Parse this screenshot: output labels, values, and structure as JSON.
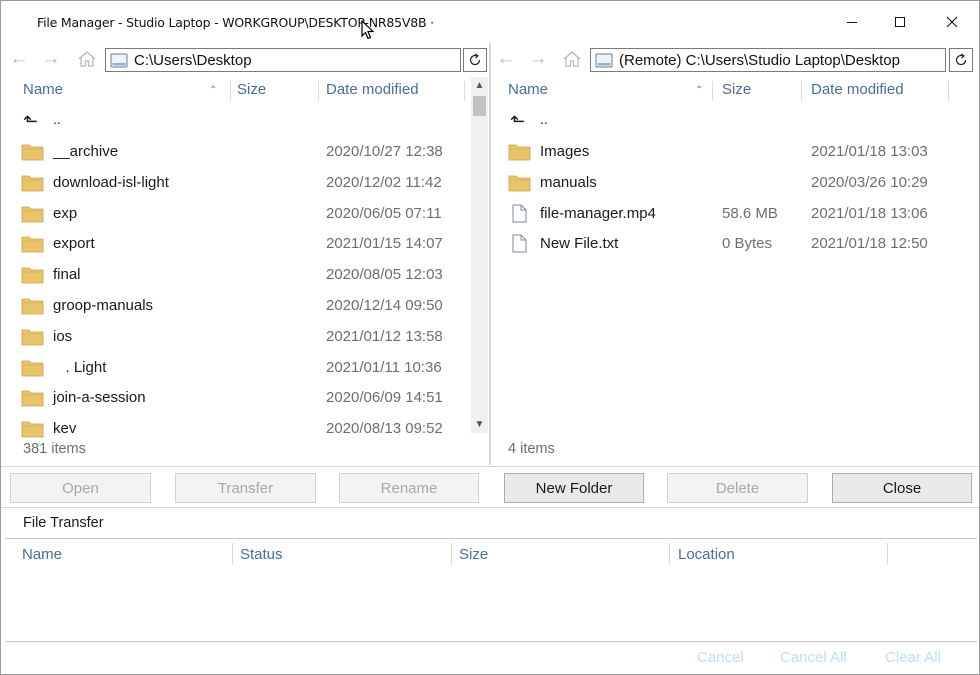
{
  "window": {
    "title": "File Manager - Studio Laptop - WORKGROUP\\DESKTOP-NR85V8B ·"
  },
  "icons": {
    "minimize": "minimize-icon",
    "maximize": "maximize-icon",
    "close": "close-icon",
    "back": "arrow-left-icon",
    "forward": "arrow-right-icon",
    "home": "home-icon",
    "drive": "drive-icon",
    "refresh": "refresh-icon",
    "folder": "folder-icon",
    "file": "file-icon",
    "parent": "parent-directory-icon"
  },
  "colors": {
    "header_text": "#4a6d9a",
    "folder": "#e9c46a",
    "disabled_link": "#bfe0f0"
  },
  "left_pane": {
    "path": "C:\\Users\\Desktop",
    "columns": {
      "name": "Name",
      "size": "Size",
      "date": "Date modified"
    },
    "parent_label": "..",
    "items": [
      {
        "name": "__archive",
        "size": "",
        "date": "2020/10/27 12:38",
        "type": "folder"
      },
      {
        "name": "download-isl-light",
        "size": "",
        "date": "2020/12/02 11:42",
        "type": "folder"
      },
      {
        "name": "exp",
        "size": "",
        "date": "2020/06/05 07:11",
        "type": "folder"
      },
      {
        "name": "export",
        "size": "",
        "date": "2021/01/15 14:07",
        "type": "folder"
      },
      {
        "name": "final",
        "size": "",
        "date": "2020/08/05 12:03",
        "type": "folder"
      },
      {
        "name": "groop-manuals",
        "size": "",
        "date": "2020/12/14 09:50",
        "type": "folder"
      },
      {
        "name": "ios",
        "size": "",
        "date": "2021/01/12 13:58",
        "type": "folder"
      },
      {
        "name": "   . Light",
        "size": "",
        "date": "2021/01/11 10:36",
        "type": "folder"
      },
      {
        "name": "join-a-session",
        "size": "",
        "date": "2020/06/09 14:51",
        "type": "folder"
      },
      {
        "name": "kev",
        "size": "",
        "date": "2020/08/13 09:52",
        "type": "folder"
      }
    ],
    "count": "381 items"
  },
  "right_pane": {
    "path": "(Remote) C:\\Users\\Studio Laptop\\Desktop",
    "columns": {
      "name": "Name",
      "size": "Size",
      "date": "Date modified"
    },
    "parent_label": "..",
    "items": [
      {
        "name": "Images",
        "size": "",
        "date": "2021/01/18 13:03",
        "type": "folder"
      },
      {
        "name": "manuals",
        "size": "",
        "date": "2020/03/26 10:29",
        "type": "folder"
      },
      {
        "name": "file-manager.mp4",
        "size": "58.6 MB",
        "date": "2021/01/18 13:06",
        "type": "file"
      },
      {
        "name": "New File.txt",
        "size": "0 Bytes",
        "date": "2021/01/18 12:50",
        "type": "file"
      }
    ],
    "count": "4 items"
  },
  "actions": {
    "open": "Open",
    "transfer": "Transfer",
    "rename": "Rename",
    "new_folder": "New Folder",
    "delete": "Delete",
    "close": "Close"
  },
  "transfer": {
    "label": "File Transfer",
    "columns": {
      "name": "Name",
      "status": "Status",
      "size": "Size",
      "location": "Location"
    },
    "cancel": "Cancel",
    "cancel_all": "Cancel All",
    "clear_all": "Clear All"
  }
}
